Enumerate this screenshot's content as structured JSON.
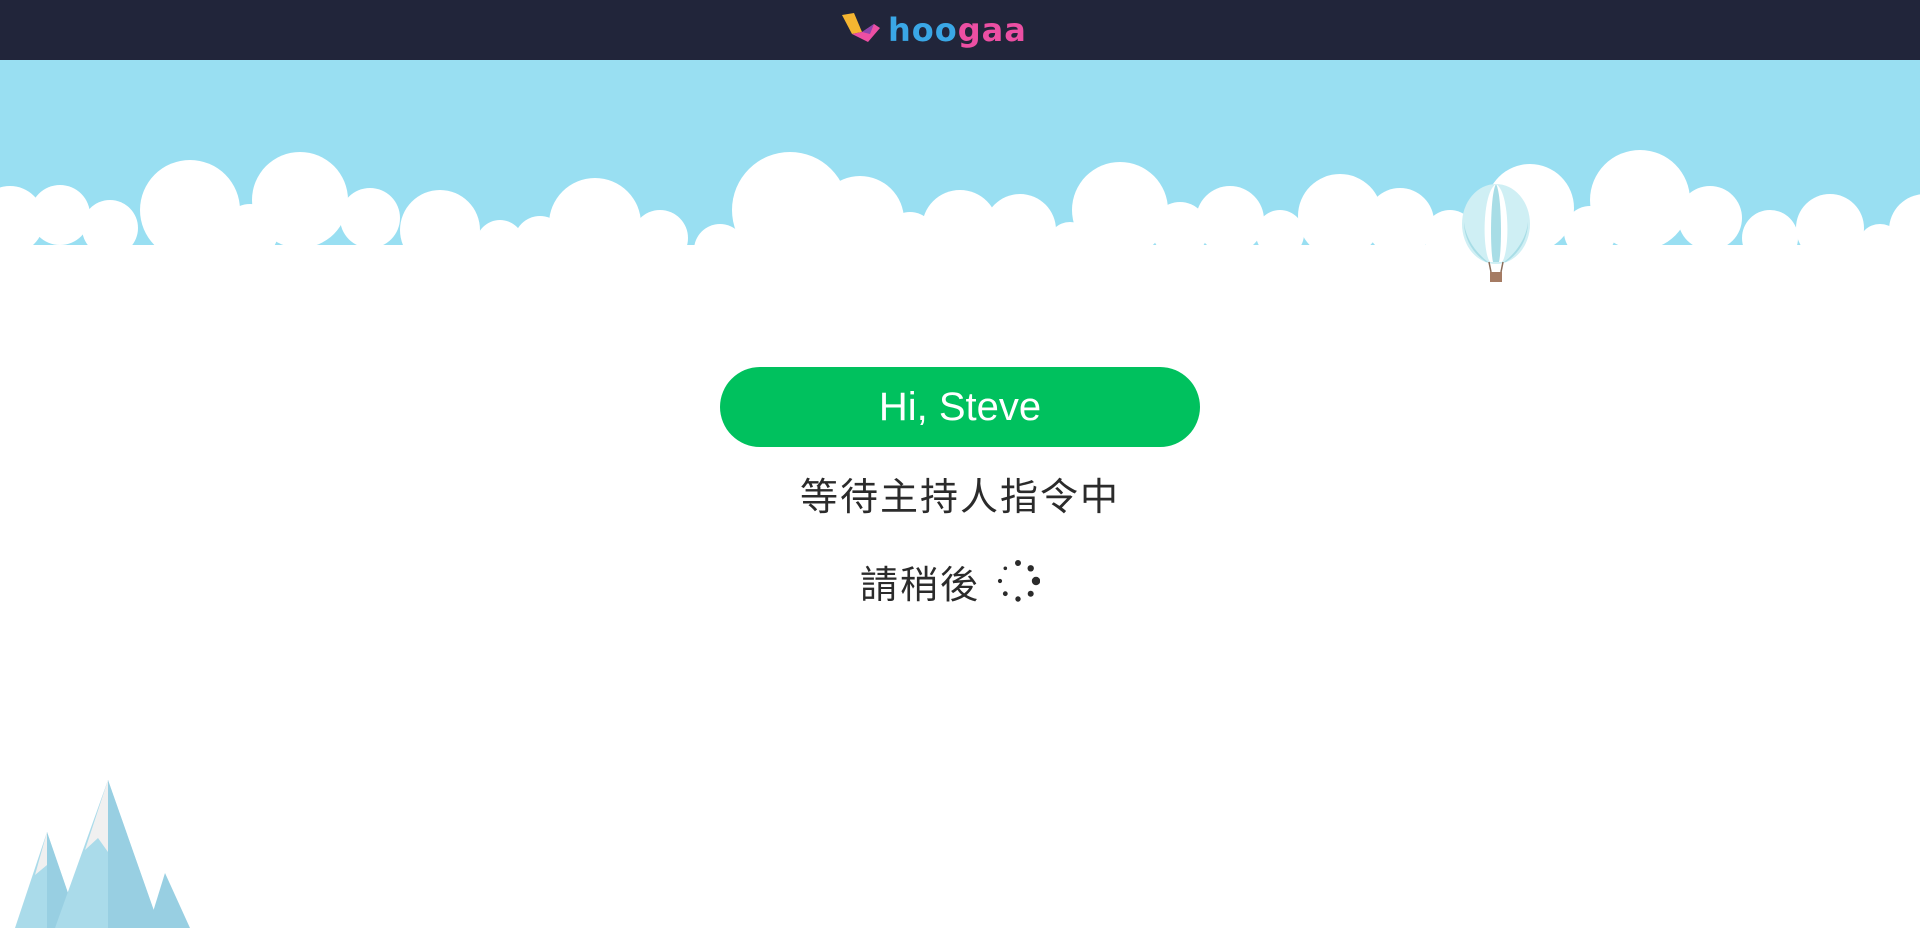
{
  "header": {
    "logo": {
      "name": "hoogaa",
      "parts": [
        "hoo",
        "gaa"
      ]
    }
  },
  "main": {
    "greeting": "Hi, Steve",
    "status_message": "等待主持人指令中",
    "please_wait": "請稍後",
    "spinner_icon": "loading-spinner-icon"
  },
  "colors": {
    "topbar_bg": "#21253a",
    "sky": "#99dff2",
    "greeting_bg": "#00c15e",
    "logo_blue": "#3aa7e6",
    "logo_pink": "#ec4fa3",
    "logo_yellow": "#f5b531"
  },
  "decor": {
    "balloon_icon": "hot-air-balloon-icon",
    "mountains_icon": "mountains-icon",
    "clouds_icon": "clouds-icon"
  }
}
